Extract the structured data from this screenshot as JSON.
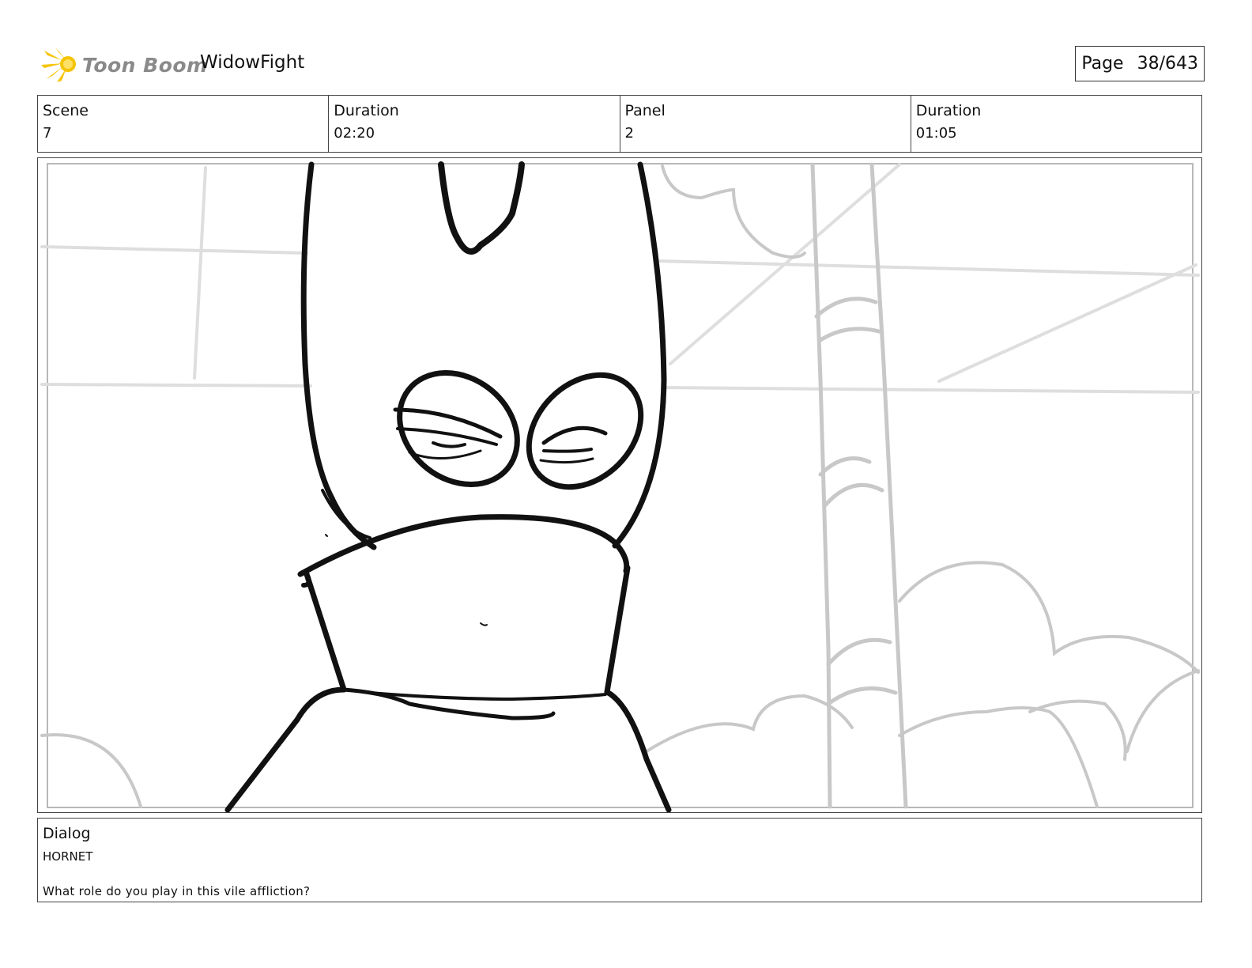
{
  "header": {
    "logo_text": "Toon Boom",
    "project_title": "WidowFight",
    "page_label": "Page",
    "page_number": "38/643"
  },
  "info": {
    "scene_label": "Scene",
    "scene_value": "7",
    "scene_duration_label": "Duration",
    "scene_duration_value": "02:20",
    "panel_label": "Panel",
    "panel_value": "2",
    "panel_duration_label": "Duration",
    "panel_duration_value": "01:05"
  },
  "panel": {
    "icon": "storyboard-sketch",
    "line_color": "#111111",
    "background_line_color": "#c8c8c8"
  },
  "dialog": {
    "label": "Dialog",
    "speaker": "HORNET",
    "line": "What role do you play in this vile affliction?"
  },
  "colors": {
    "logo_yellow": "#f5c400",
    "logo_text": "#8a8a8a",
    "border": "#444444"
  }
}
